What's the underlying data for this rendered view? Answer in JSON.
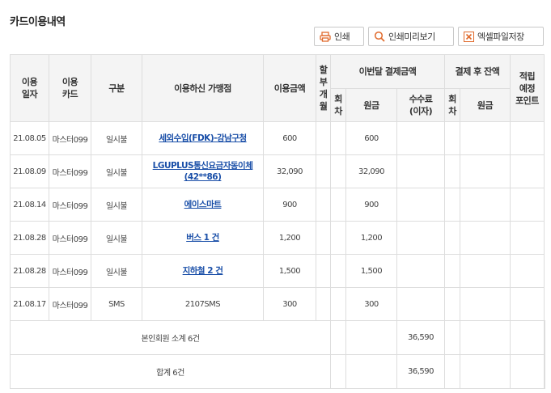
{
  "page_title": "카드이용내역",
  "buttons": {
    "print": "인쇄",
    "preview": "인쇄미리보기",
    "excel": "엑셀파일저장"
  },
  "table": {
    "headers": {
      "date": "이용\n일자",
      "card": "이용\n카드",
      "type": "구분",
      "merchant": "이용하신 가맹점",
      "amount": "이용금액",
      "installment": "할\n부\n개\n월",
      "this_month": "이번달 결제금액",
      "after_balance": "결제 후 잔액",
      "points": "적립\n예정\n포인트",
      "round": "회\n차",
      "principal": "원금",
      "fee": "수수료\n(이자)",
      "round2": "회\n차",
      "principal2": "원금"
    },
    "rows": [
      {
        "date": "21.08.05",
        "card": "마스터099",
        "type": "일시불",
        "merchant": "세외수입(FDK)-강남구청",
        "link": true,
        "amount": "600",
        "principal": "600"
      },
      {
        "date": "21.08.09",
        "card": "마스터099",
        "type": "일시불",
        "merchant": "LGUPLUS통신요금자동이체(42**86)",
        "link": true,
        "amount": "32,090",
        "principal": "32,090"
      },
      {
        "date": "21.08.14",
        "card": "마스터099",
        "type": "일시불",
        "merchant": "에이스마트",
        "link": true,
        "amount": "900",
        "principal": "900"
      },
      {
        "date": "21.08.28",
        "card": "마스터099",
        "type": "일시불",
        "merchant": "버스 1 건",
        "link": true,
        "amount": "1,200",
        "principal": "1,200"
      },
      {
        "date": "21.08.28",
        "card": "마스터099",
        "type": "일시불",
        "merchant": "지하철 2 건",
        "link": true,
        "amount": "1,500",
        "principal": "1,500"
      },
      {
        "date": "21.08.17",
        "card": "마스터099",
        "type": "SMS",
        "merchant": "2107SMS",
        "link": false,
        "amount": "300",
        "principal": "300"
      }
    ],
    "subtotal": {
      "label": "본인회원 소계 6건",
      "principal": "36,590"
    },
    "total": {
      "label": "합계 6건",
      "principal": "36,590"
    }
  },
  "colors": {
    "accent": "#e06a2c",
    "link": "#1a4fa8",
    "header_bg": "#f4f4f4",
    "border": "#dddddd"
  },
  "icons": {
    "print": "printer-icon",
    "preview": "magnifier-icon",
    "excel": "excel-icon"
  }
}
